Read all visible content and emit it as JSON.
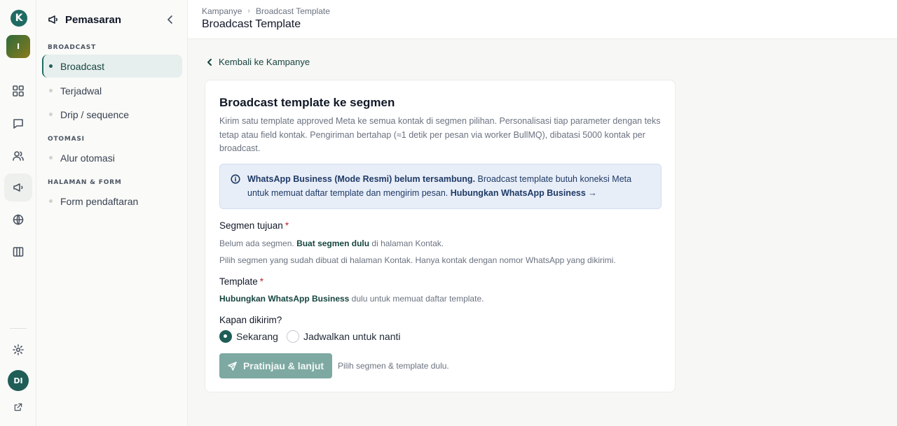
{
  "rail": {
    "logo_letter": "K",
    "workspace_initial": "I",
    "user_initials": "DI"
  },
  "sidebar": {
    "title": "Pemasaran",
    "groups": [
      {
        "label": "BROADCAST",
        "items": [
          "Broadcast",
          "Terjadwal",
          "Drip / sequence"
        ]
      },
      {
        "label": "OTOMASI",
        "items": [
          "Alur otomasi"
        ]
      },
      {
        "label": "HALAMAN & FORM",
        "items": [
          "Form pendaftaran"
        ]
      }
    ],
    "active_item": "Broadcast"
  },
  "header": {
    "breadcrumb": [
      "Kampanye",
      "Broadcast Template"
    ],
    "title": "Broadcast Template"
  },
  "main": {
    "back_link": "Kembali ke Kampanye",
    "card": {
      "title": "Broadcast template ke segmen",
      "description": "Kirim satu template approved Meta ke semua kontak di segmen pilihan. Personalisasi tiap parameter dengan teks tetap atau field kontak. Pengiriman bertahap (≈1 detik per pesan via worker BullMQ), dibatasi 5000 kontak per broadcast.",
      "alert": {
        "bold": "WhatsApp Business (Mode Resmi) belum tersambung.",
        "text": " Broadcast template butuh koneksi Meta untuk memuat daftar template dan mengirim pesan. ",
        "link": "Hubungkan WhatsApp Business →"
      },
      "segment": {
        "label": "Segmen tujuan",
        "required_mark": "*",
        "empty_prefix": "Belum ada segmen. ",
        "empty_link": "Buat segmen dulu",
        "empty_suffix": " di halaman Kontak.",
        "hint": "Pilih segmen yang sudah dibuat di halaman Kontak. Hanya kontak dengan nomor WhatsApp yang dikirimi."
      },
      "template": {
        "label": "Template",
        "required_mark": "*",
        "link": "Hubungkan WhatsApp Business",
        "suffix": " dulu untuk memuat daftar template."
      },
      "schedule": {
        "label": "Kapan dikirim?",
        "options": [
          "Sekarang",
          "Jadwalkan untuk nanti"
        ],
        "selected": "Sekarang"
      },
      "submit_label": "Pratinjau & lanjut",
      "submit_hint": "Pilih segmen & template dulu."
    }
  },
  "colors": {
    "brand": "#1f5e57",
    "alert_bg": "#e8eef8",
    "required": "#c0262d"
  }
}
